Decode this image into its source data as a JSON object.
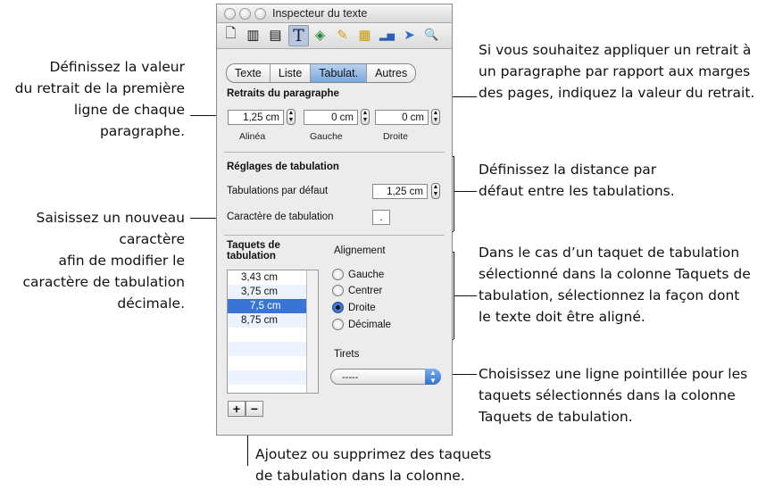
{
  "window": {
    "title": "Inspecteur du texte"
  },
  "toolbar": {
    "icons": [
      "document-icon",
      "layout-icon",
      "wrap-icon",
      "text-icon",
      "graphic-icon",
      "metrics-icon",
      "table-icon",
      "chart-icon",
      "link-icon",
      "quicktime-icon"
    ],
    "glyphs": [
      "🗋",
      "▥",
      "▤",
      "T",
      "◈",
      "✎",
      "▦",
      "▂▅",
      "➤",
      "🔍"
    ]
  },
  "segments": [
    "Texte",
    "Liste",
    "Tabulat.",
    "Autres"
  ],
  "indents": {
    "heading": "Retraits du paragraphe",
    "first_value": "1,25 cm",
    "first_label": "Alinéa",
    "left_value": "0 cm",
    "left_label": "Gauche",
    "right_value": "0 cm",
    "right_label": "Droite"
  },
  "tab_settings": {
    "heading": "Réglages de tabulation",
    "default_label": "Tabulations par défaut",
    "default_value": "1,25 cm",
    "char_label": "Caractère de tabulation",
    "char_value": "."
  },
  "tab_stops": {
    "heading_line1": "Taquets de",
    "heading_line2": "tabulation",
    "items": [
      "3,43 cm",
      "3,75 cm",
      "7,5 cm",
      "8,75 cm"
    ],
    "selected_index": 2
  },
  "alignment": {
    "heading": "Alignement",
    "options": [
      "Gauche",
      "Centrer",
      "Droite",
      "Décimale"
    ],
    "selected": "Droite"
  },
  "leader": {
    "label": "Tirets",
    "value": "-----"
  },
  "buttons": {
    "add": "+",
    "remove": "−"
  },
  "callouts": {
    "left1": [
      "Définissez la valeur",
      "du retrait de la première",
      "ligne de chaque",
      "paragraphe."
    ],
    "left2": [
      "Saisissez un nouveau",
      "caractère",
      "afin de modifier le",
      "caractère de tabulation",
      "décimale."
    ],
    "right1": [
      "Si vous souhaitez appliquer un retrait à",
      "un paragraphe par rapport aux marges",
      "des pages, indiquez la valeur du retrait."
    ],
    "right2": [
      "Définissez la distance par",
      "défaut entre les tabulations."
    ],
    "right3": [
      "Dans le cas d’un taquet de tabulation",
      "sélectionné dans la colonne Taquets de",
      "tabulation, sélectionnez la façon dont",
      "le texte doit être aligné."
    ],
    "right4": [
      "Choisissez une ligne pointillée pour les",
      "taquets sélectionnés dans la colonne",
      "Taquets de tabulation."
    ],
    "bottom": [
      "Ajoutez ou supprimez des taquets",
      "de tabulation dans la colonne."
    ]
  }
}
